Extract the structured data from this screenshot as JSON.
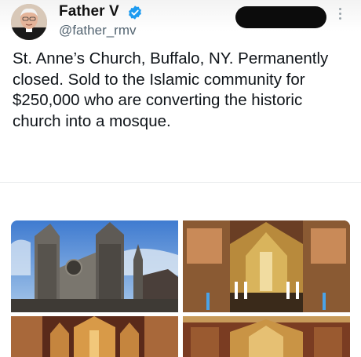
{
  "author": {
    "display_name": "Father V",
    "handle": "@father_rmv",
    "avatar_icon": "priest-avatar",
    "verified_icon": "verified-badge-icon",
    "verified_color": "#1d9bf0"
  },
  "tweet": {
    "text": "St. Anne’s Church, Buffalo, NY. Permanently closed. Sold to the Islamic community for $250,000 who are converting the historic church into a mosque."
  },
  "media": [
    {
      "name": "church-exterior-photo"
    },
    {
      "name": "church-altar-photo"
    },
    {
      "name": "church-interior-photo"
    },
    {
      "name": "church-altar-detail-photo"
    }
  ],
  "colors": {
    "text": "#0f1419",
    "secondary": "#536471",
    "redaction": "#0c0c0c"
  }
}
